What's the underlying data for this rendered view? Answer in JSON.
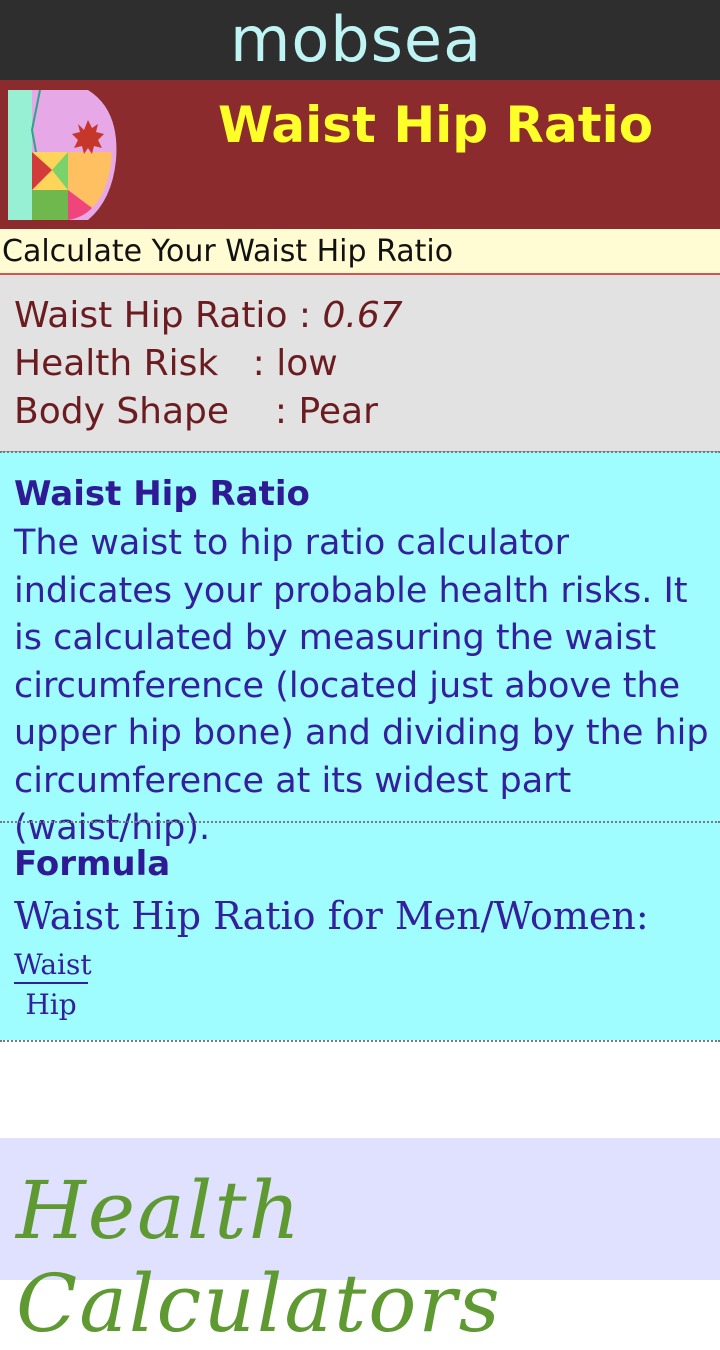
{
  "app": {
    "brand": "mobsea",
    "title": "Waist Hip Ratio",
    "subtitle": "Calculate Your Waist Hip Ratio"
  },
  "results": {
    "ratio_label": "Waist Hip Ratio :",
    "ratio_value": "0.67",
    "risk_label": "Health Risk",
    "risk_sep": ":",
    "risk_value": "low",
    "shape_label": "Body Shape",
    "shape_sep": ":",
    "shape_value": "Pear"
  },
  "info": {
    "heading": "Waist Hip Ratio",
    "text": "The waist to hip ratio calculator indicates your probable health risks. It is calculated by measuring the waist circumference (located just above the upper hip bone) and dividing by the hip circumference at its widest part (waist/hip)."
  },
  "formula": {
    "heading": "Formula",
    "subtitle": "Waist Hip Ratio for Men/Women:",
    "numerator": "Waist",
    "denominator": "Hip"
  },
  "banner": {
    "text": "Health Calculators"
  },
  "colors": {
    "topbar": "#2e2e2e",
    "brand": "#bff4f4",
    "header": "#8c2b2e",
    "title": "#ffff2a",
    "info_bg": "#9ffcff",
    "info_text": "#33209c",
    "result_text": "#6b1c20",
    "banner_text": "#5e9a31"
  }
}
